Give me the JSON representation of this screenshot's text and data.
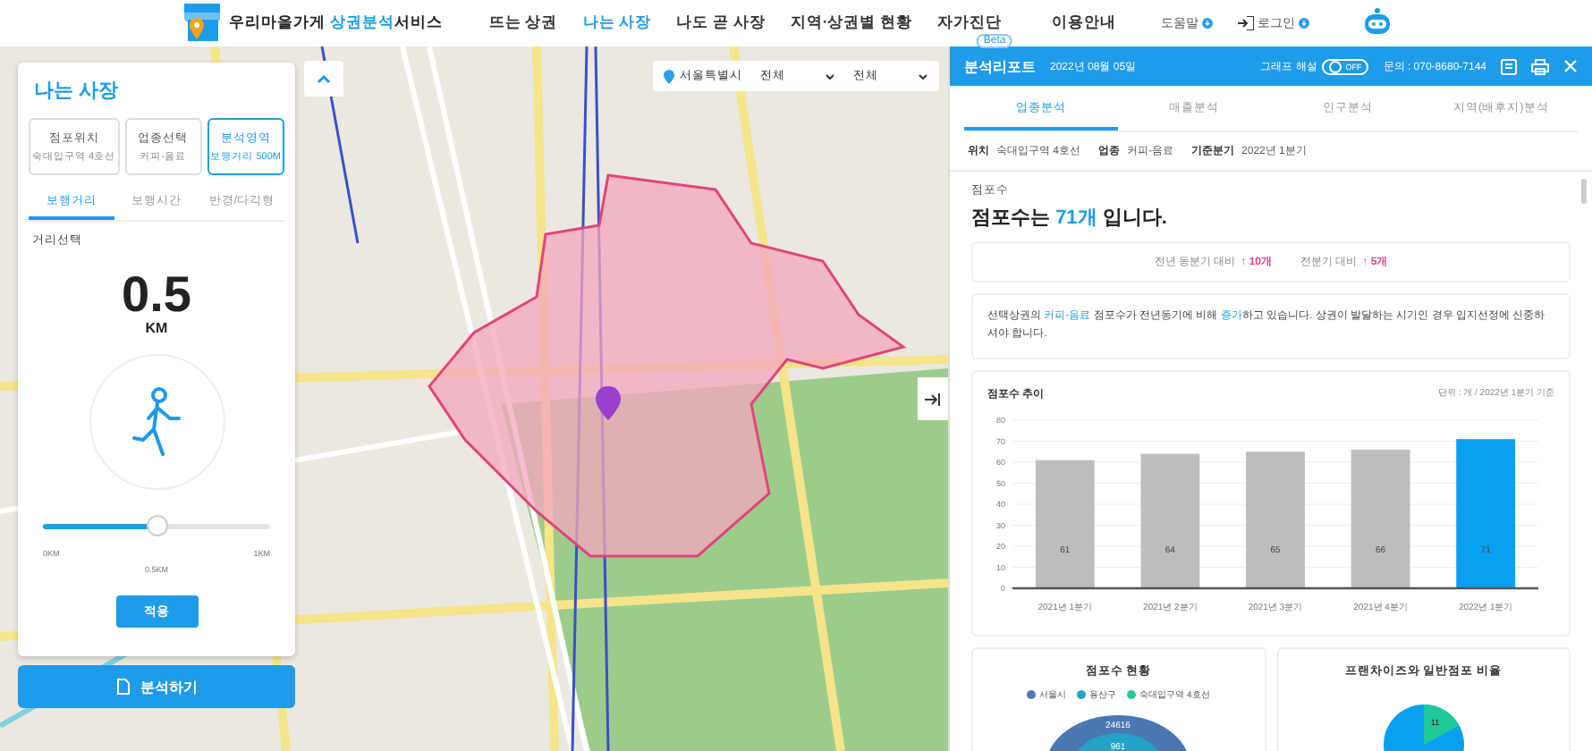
{
  "header": {
    "brand": [
      {
        "text": "우리마을가게 ",
        "highlight": false
      },
      {
        "text": "상권분석",
        "highlight": true
      },
      {
        "text": "서비스",
        "highlight": false
      }
    ],
    "nav": [
      {
        "label": "뜨는 상권",
        "selected": false
      },
      {
        "label": "나는 사장",
        "selected": true
      },
      {
        "label": "나도 곧 사장",
        "selected": false
      },
      {
        "label": "지역·상권별 현황",
        "selected": false
      },
      {
        "label": "자가진단",
        "selected": false,
        "badge": "Beta"
      },
      {
        "label": "이용안내",
        "selected": false
      }
    ],
    "utility": [
      {
        "label": "도움말",
        "kind": "help"
      },
      {
        "label": "로그인",
        "kind": "login"
      }
    ]
  },
  "map": {
    "region": {
      "city": "서울특별시",
      "district": "전체",
      "area": "전체"
    }
  },
  "left_panel": {
    "title": "나는 사장",
    "steps": [
      {
        "title": "점포위치",
        "value": "숙대입구역 4호선",
        "selected": false
      },
      {
        "title": "업종선택",
        "value": "커피-음료",
        "selected": false
      },
      {
        "title": "분석영역",
        "value": "보행거리 500M",
        "selected": true
      }
    ],
    "tabs": [
      {
        "label": "보행거리",
        "selected": true
      },
      {
        "label": "보행시간",
        "selected": false
      },
      {
        "label": "반경/다각형",
        "selected": false
      }
    ],
    "section_label": "거리선택",
    "distance": "0.5",
    "unit": "KM",
    "slider": {
      "level": 0.5,
      "min_label": "0KM",
      "mid_label": "0.5KM",
      "max_label": "1KM"
    },
    "apply_button": "적용",
    "analyze_button": "분석하기"
  },
  "report": {
    "title": "분석리포트",
    "date": "2022년 08월 05일",
    "toggle": {
      "label": "그래프 해설",
      "on": false,
      "state_text": "OFF"
    },
    "contact": "문의 : 070-8680-7144",
    "tabs": [
      {
        "label": "업종분석",
        "selected": true
      },
      {
        "label": "매출분석",
        "selected": false
      },
      {
        "label": "인구분석",
        "selected": false
      },
      {
        "label": "지역(배후지)분석",
        "selected": false
      }
    ],
    "info": [
      {
        "key": "위치",
        "value": "숙대입구역 4호선"
      },
      {
        "key": "업종",
        "value": "커피-음료"
      },
      {
        "key": "기준분기",
        "value": "2022년 1분기"
      }
    ],
    "section_label": "점포수",
    "headline": [
      {
        "text": "점포수는 ",
        "highlight": false
      },
      {
        "text": "71개",
        "highlight": true
      },
      {
        "text": " 입니다.",
        "highlight": false
      }
    ],
    "comparisons": [
      {
        "label": "전년 동분기 대비",
        "value": "↑ 10개"
      },
      {
        "label": "전분기 대비",
        "value": "↑ 5개"
      }
    ],
    "note": [
      {
        "text": "선택상권의 ",
        "highlight": false
      },
      {
        "text": "커피-음료",
        "highlight": true
      },
      {
        "text": " 점포수가 전년동기에 비해 ",
        "highlight": false
      },
      {
        "text": "증가",
        "highlight": true
      },
      {
        "text": "하고 있습니다. 상권이 발달하는 시기인 경우 입지선정에 신중하셔야 합니다.",
        "highlight": false
      }
    ],
    "trend": {
      "title": "점포수 추이",
      "unit": "단위 : 개 / 2022년 1분기 기준",
      "chart_data": {
        "type": "bar",
        "categories": [
          "2021년 1분기",
          "2021년 2분기",
          "2021년 3분기",
          "2021년 4분기",
          "2022년 1분기"
        ],
        "series": [
          {
            "color": "#bdbdbd",
            "values": [
              61,
              64,
              65,
              66,
              null
            ]
          },
          {
            "color": "#0aa0f0",
            "values": [
              null,
              null,
              null,
              null,
              71
            ]
          }
        ],
        "grid": true,
        "ylim": [
          0,
          80
        ],
        "yticks": [
          0,
          10,
          20,
          30,
          40,
          50,
          60,
          70,
          80
        ],
        "data_labels": true
      }
    },
    "status": {
      "title": "점포수 현황",
      "legend": [
        {
          "label": "서울시",
          "color": "#4a78b0"
        },
        {
          "label": "용산구",
          "color": "#24a3c8"
        },
        {
          "label": "숙대입구역 4호선",
          "color": "#20c997"
        }
      ],
      "ring_labels": [
        "24616",
        "961"
      ]
    },
    "ratio": {
      "title": "프랜차이즈와 일반점포 비율",
      "slice_label": "11"
    }
  }
}
